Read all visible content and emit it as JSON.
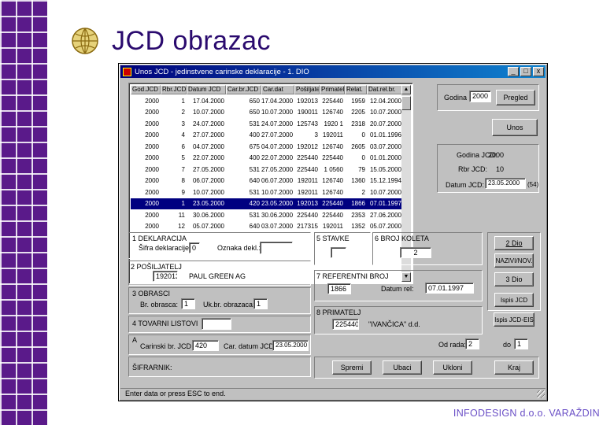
{
  "slide": {
    "title": "JCD obrazac",
    "footer": "INFODESIGN d.o.o. VARAŽDIN"
  },
  "window": {
    "title": "Unos JCD - jedinstvene carinske deklaracije - 1. DIO",
    "min_label": "_",
    "max_label": "□",
    "close_label": "x"
  },
  "table": {
    "columns": [
      "God.JCD",
      "Rbr.JCD",
      "Datum JCD",
      "Car.br.JCD",
      "Car.dat",
      "Pošiljatelj",
      "Primatelj",
      "Relat.",
      "Dat.rel.br."
    ],
    "rows": [
      [
        "2000",
        "1",
        "17.04.2000",
        "650",
        "17.04.2000",
        "192013",
        "225440",
        "1959",
        "12.04.2000"
      ],
      [
        "2000",
        "2",
        "10.07.2000",
        "650",
        "10.07.2000",
        "190011",
        "126740",
        "2205",
        "10.07.2000"
      ],
      [
        "2000",
        "3",
        "24.07.2000",
        "531",
        "24.07.2000",
        "125743",
        "1920 1",
        "2318",
        "20.07.2000"
      ],
      [
        "2000",
        "4",
        "27.07.2000",
        "400",
        "27.07.2000",
        "3",
        "192011",
        "0",
        "01.01.1996"
      ],
      [
        "2000",
        "6",
        "04.07.2000",
        "675",
        "04.07.2000",
        "192012",
        "126740",
        "2605",
        "03.07.2000"
      ],
      [
        "2000",
        "5",
        "22.07.2000",
        "400",
        "22.07.2000",
        "225440",
        "225440",
        "0",
        "01.01.2000"
      ],
      [
        "2000",
        "7",
        "27.05.2000",
        "531",
        "27.05.2000",
        "225440",
        "1 0560",
        "79",
        "15.05.2000"
      ],
      [
        "2000",
        "8",
        "06.07.2000",
        "640",
        "06.07.2000",
        "192011",
        "126740",
        "1360",
        "15.12.1994"
      ],
      [
        "2000",
        "9",
        "10.07.2000",
        "531",
        "10.07.2000",
        "192011",
        "126740",
        "2",
        "10.07.2000"
      ],
      [
        "2000",
        "1",
        "23.05.2000",
        "420",
        "23.05.2000",
        "192013",
        "225440",
        "1866",
        "07.01.1997"
      ],
      [
        "2000",
        "11",
        "30.06.2000",
        "531",
        "30.06.2000",
        "225440",
        "225440",
        "2353",
        "27.06.2000"
      ],
      [
        "2000",
        "12",
        "05.07.2000",
        "640",
        "03.07.2000",
        "217315",
        "192011",
        "1352",
        "05.07.2000"
      ]
    ],
    "selected_row_index": 9
  },
  "right_top": {
    "godina_label": "Godina",
    "godina_value": "2000",
    "pregled_button": "Pregled",
    "unos_button": "Unos",
    "info_godina_label": "Godina JCD:",
    "info_godina_value": "2000",
    "info_rbr_label": "Rbr JCD:",
    "info_rbr_value": "10",
    "info_datum_label": "Datum JCD:",
    "info_datum_value": "23.05.2000",
    "info_datum_suffix": "(54)"
  },
  "deklaracija": {
    "section": "1 DEKLARACIJA",
    "sifra_label": "Šifra deklaracije:",
    "sifra_value": "0",
    "oznaka_label": "Oznaka dekl.:",
    "oznaka_value": ""
  },
  "posiljatelj": {
    "section": "2 POŠILJATELJ",
    "code": "192013",
    "name": "PAUL GREEN AG"
  },
  "obrasci": {
    "section": "3 OBRASCI",
    "broj_label": "Br. obrasca:",
    "broj_value": "1",
    "uk_label": "Uk.br. obrazaca:",
    "uk_value": "1"
  },
  "tovarni": {
    "section": "4 TOVARNI LISTOVI",
    "value": ""
  },
  "carina": {
    "section": "A",
    "carbr_label": "Carinski br. JCD",
    "carbr_value": "420",
    "cardat_label": "Car. datum JCD",
    "cardat_value": "23.05.2000"
  },
  "sifrarnik": {
    "label": "ŠIFRARNIK:"
  },
  "stavke": {
    "section": "5 STAVKE",
    "value": ""
  },
  "koleta": {
    "section": "6 BROJ KOLETA",
    "value": "2"
  },
  "referentni": {
    "section": "7 REFERENTNI BROJ",
    "value": "1866",
    "datum_label": "Datum rel:",
    "datum_value": "07.01.1997"
  },
  "primatelj": {
    "section": "8 PRIMATELJ",
    "code": "225440",
    "name": "\"IVANČICA\" d.d."
  },
  "side_buttons": {
    "dio2": "2 Dio",
    "nazivi": "NAZIVI/NOV.",
    "dio3": "3 Dio",
    "ispis_jcd": "Ispis JCD",
    "ispis_eis": "Ispis JCD-EIS"
  },
  "bottom": {
    "od_label": "Od rada:",
    "od_value": "2",
    "do_label": "do",
    "do_value": "1",
    "spremi": "Spremi",
    "ubaci": "Ubaci",
    "ukloni": "Ukloni",
    "kraj": "Kraj"
  },
  "status": {
    "text": "Enter data or press ESC to end."
  },
  "colors": {
    "slide_purple": "#5a1a8a",
    "title_blue": "#2a0a6e",
    "win_gray": "#c0c0c0",
    "selection": "#000080"
  }
}
